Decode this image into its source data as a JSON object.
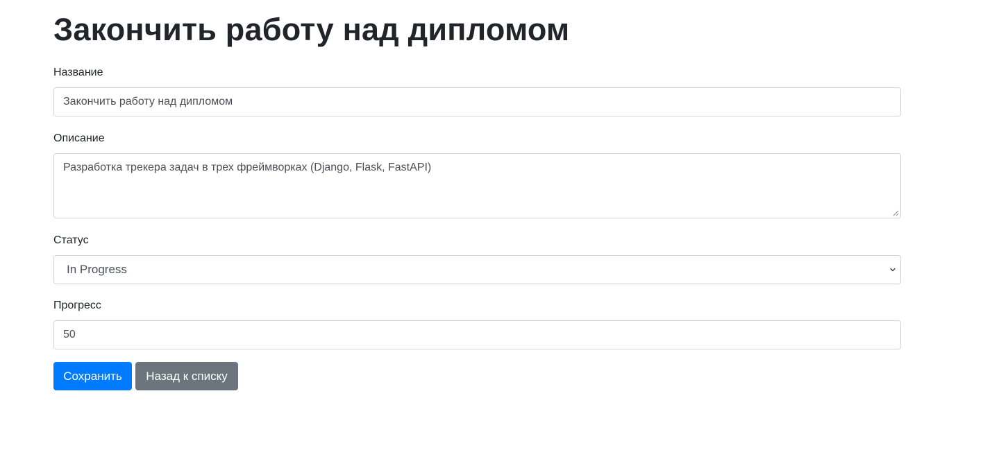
{
  "header": {
    "title": "Закончить работу над дипломом"
  },
  "form": {
    "name": {
      "label": "Название",
      "value": "Закончить работу над дипломом"
    },
    "description": {
      "label": "Описание",
      "value": "Разработка трекера задач в трех фреймворках (Django, Flask, FastAPI)"
    },
    "status": {
      "label": "Статус",
      "selected": "In Progress"
    },
    "progress": {
      "label": "Прогресс",
      "value": "50"
    }
  },
  "actions": {
    "save_label": "Сохранить",
    "back_label": "Назад к списку"
  },
  "colors": {
    "primary": "#007bff",
    "secondary": "#6c757d",
    "border": "#ced4da",
    "text": "#212529"
  },
  "icons": {
    "select_arrow": "chevron-down-icon",
    "textarea_resize": "resize-grip-icon"
  }
}
